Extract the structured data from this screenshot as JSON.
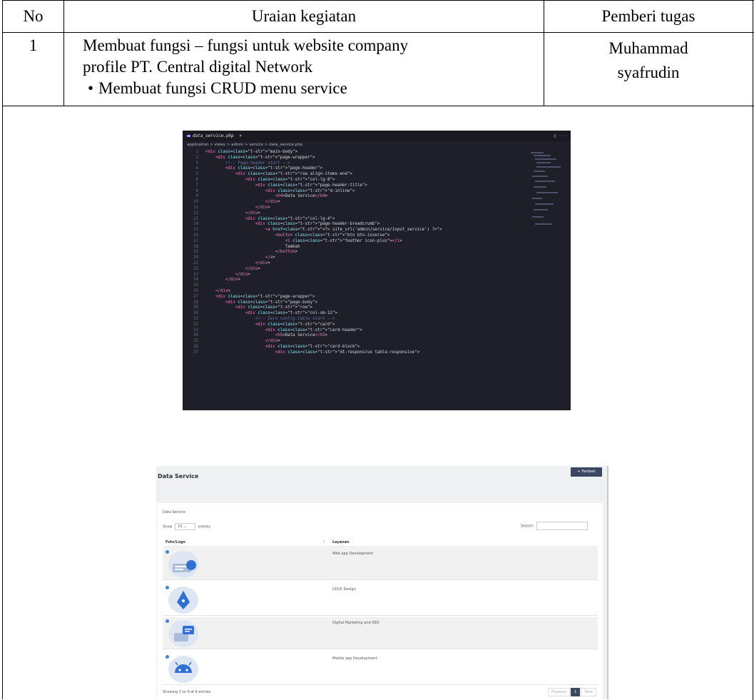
{
  "table": {
    "headers": {
      "no": "No",
      "uraian": "Uraian kegiatan",
      "pemberi": "Pemberi tugas"
    },
    "row1": {
      "no": "1",
      "uraian_line1": "Membuat fungsi – fungsi untuk website company",
      "uraian_line2": "profile PT. Central digital Network",
      "bullet": "Membuat fungsi CRUD menu service",
      "pemberi_line1": "Muhammad",
      "pemberi_line2": "syafrudin"
    }
  },
  "editor": {
    "tab_name": "data_service.php",
    "tab_close": "×",
    "layout_icon": "split-editor-icon",
    "breadcrumb": "application > views > admin > service > data_service.php",
    "colors": {
      "background": "#1e1f29",
      "tag": "#ff79c6",
      "attr": "#8be9fd",
      "string": "#f1fa8c",
      "comment": "#6272a4"
    },
    "lines": [
      "<div class=\"main-body\">",
      "    <div class=\"page-wrapper\">",
      "        <!-- Page-header start -->",
      "        <div class=\"page-header\">",
      "            <div class=\"row align-items-end\">",
      "                <div class=\"col-lg-8\">",
      "                    <div class=\"page-header-title\">",
      "                        <div class=\"d-inline\">",
      "                            <h4>Data Service</h4>",
      "                        </div>",
      "                    </div>",
      "                </div>",
      "                <div class=\"col-lg-4\">",
      "                    <div class=\"page-header-breadcrumb\">",
      "                        <a href=\"<?= site_url('admin/service/input_service') ?>\">",
      "                            <button class=\"btn btn-inverse\">",
      "                                <i class=\"feather icon-plus\"></i>",
      "                                Tambah",
      "                            </button>",
      "                        </a>",
      "                    </div>",
      "                </div>",
      "            </div>",
      "        </div>",
      "",
      "    </div>",
      "    <div class=\"page-wrapper\">",
      "        <div class=\"page-body\">",
      "            <div class=\"row\">",
      "                <div class=\"col-sm-12\">",
      "                    <!-- Zero config.table start -->",
      "                    <div class=\"card\">",
      "                        <div class=\"card-header\">",
      "                            <h5>Data Service</h5>",
      "                        </div>",
      "                        <div class=\"card-block\">",
      "                            <div class=\"dt-responsive table-responsive\">"
    ]
  },
  "webpage": {
    "title": "Data Service",
    "add_button": "+ Tambah",
    "card_title": "Data Service",
    "show_label": "Show",
    "entries_value": "10",
    "entries_label": "entries",
    "search_label": "Search:",
    "col_foto": "Foto/Logo",
    "col_layanan": "Layanan",
    "sort_icon": "↑",
    "rows": [
      {
        "layanan": "Web app Development",
        "icon": "web-dev-icon"
      },
      {
        "layanan": "UI/UX Design",
        "icon": "pen-nib-icon"
      },
      {
        "layanan": "Digital Marketing and SEO",
        "icon": "marketing-icon"
      },
      {
        "layanan": "Mobile app Development",
        "icon": "android-icon"
      }
    ],
    "footer": "Showing 1 to 4 of 4 entries",
    "pager_prev": "Previous",
    "pager_page": "1",
    "pager_next": "Next",
    "accent": "#3b4761"
  }
}
